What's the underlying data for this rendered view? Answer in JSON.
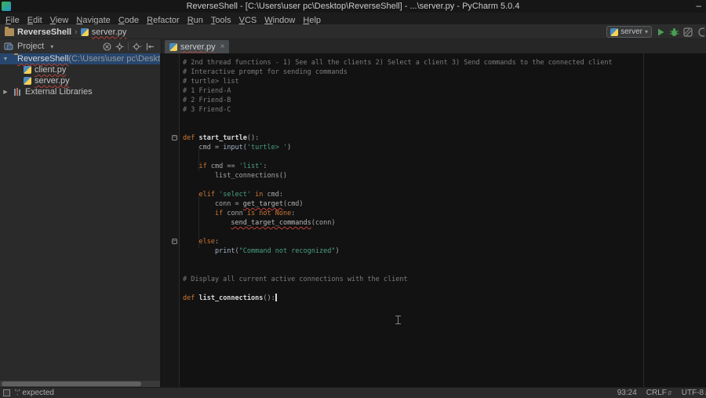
{
  "icons": {
    "minimize": "–",
    "breadcrumb_sep": "›",
    "dropdown": "▾",
    "tree_expanded": "▼",
    "tree_collapsed": "▶",
    "tab_close": "×",
    "fold_collapse": "−",
    "fold_end": "⌐",
    "updown": "⇵"
  },
  "window": {
    "title": "ReverseShell - [C:\\Users\\user pc\\Desktop\\ReverseShell] - ...\\server.py - PyCharm 5.0.4"
  },
  "menu": {
    "items": [
      "File",
      "Edit",
      "View",
      "Navigate",
      "Code",
      "Refactor",
      "Run",
      "Tools",
      "VCS",
      "Window",
      "Help"
    ]
  },
  "navbar": {
    "root": "ReverseShell",
    "file": "server.py",
    "run_config": "server"
  },
  "project_panel": {
    "title": "Project",
    "root_name": "ReverseShell",
    "root_path": " (C:\\Users\\user pc\\Desktop\\Reverse",
    "files": [
      "client.py",
      "server.py"
    ],
    "external": "External Libraries"
  },
  "tab": {
    "label": "server.py"
  },
  "editor": {
    "lines": [
      [
        [
          "com",
          "# 2nd thread functions - 1) See all the clients 2) Select a client 3) Send commands to the connected client"
        ]
      ],
      [
        [
          "com",
          "# Interactive prompt for sending commands"
        ]
      ],
      [
        [
          "com",
          "# turtle> list"
        ]
      ],
      [
        [
          "com",
          "# 1 Friend-A"
        ]
      ],
      [
        [
          "com",
          "# 2 Friend-B"
        ]
      ],
      [
        [
          "com",
          "# 3 Friend-C"
        ]
      ],
      [],
      [],
      [
        [
          "kw",
          "def "
        ],
        [
          "fn",
          "start_turtle"
        ],
        [
          "pl",
          "():"
        ]
      ],
      [
        [
          "pl",
          "    cmd = "
        ],
        [
          "bi",
          "input"
        ],
        [
          "pl",
          "("
        ],
        [
          "str",
          "'turtle> '"
        ],
        [
          "pl",
          ")"
        ]
      ],
      [],
      [
        [
          "pl",
          "    "
        ],
        [
          "kw",
          "if"
        ],
        [
          "pl",
          " cmd == "
        ],
        [
          "str",
          "'list'"
        ],
        [
          "pl",
          ":"
        ]
      ],
      [
        [
          "pl",
          "        list_connections()"
        ]
      ],
      [],
      [
        [
          "pl",
          "    "
        ],
        [
          "kw",
          "elif"
        ],
        [
          "pl",
          " "
        ],
        [
          "str",
          "'select'"
        ],
        [
          "pl",
          " "
        ],
        [
          "kw",
          "in"
        ],
        [
          "pl",
          " cmd:"
        ]
      ],
      [
        [
          "pl",
          "        conn = "
        ],
        [
          "err",
          "get_target"
        ],
        [
          "pl",
          "(cmd)"
        ]
      ],
      [
        [
          "pl",
          "        "
        ],
        [
          "kw",
          "if"
        ],
        [
          "pl",
          " conn "
        ],
        [
          "kw",
          "is"
        ],
        [
          "pl",
          " "
        ],
        [
          "kw",
          "not"
        ],
        [
          "pl",
          " "
        ],
        [
          "kw",
          "None"
        ],
        [
          "pl",
          ":"
        ]
      ],
      [
        [
          "pl",
          "            "
        ],
        [
          "err",
          "send_target_commands"
        ],
        [
          "pl",
          "(conn)"
        ]
      ],
      [],
      [
        [
          "pl",
          "    "
        ],
        [
          "kw",
          "else"
        ],
        [
          "pl",
          ":"
        ]
      ],
      [
        [
          "pl",
          "        "
        ],
        [
          "bi",
          "print"
        ],
        [
          "pl",
          "("
        ],
        [
          "str",
          "\"Command not recognized\""
        ],
        [
          "pl",
          ")"
        ]
      ],
      [],
      [],
      [
        [
          "com",
          "# Display all current active connections with the client"
        ]
      ],
      [],
      [
        [
          "kw",
          "def "
        ],
        [
          "fn",
          "list_connections"
        ],
        [
          "pl",
          "():"
        ],
        [
          "caret",
          ""
        ]
      ]
    ]
  },
  "status": {
    "message": "':' expected",
    "position": "93:24",
    "line_sep": "CRLF",
    "encoding": "UTF-8"
  }
}
